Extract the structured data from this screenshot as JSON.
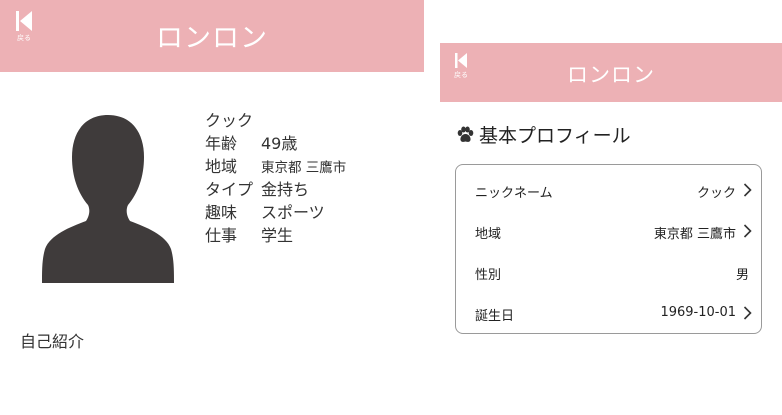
{
  "left_screen": {
    "header": {
      "title": "ロンロン",
      "back_label": "戻る"
    },
    "profile": {
      "nickname": "クック",
      "rows": [
        {
          "label": "年齢",
          "value": "49歳"
        },
        {
          "label": "地域",
          "value": "東京都 三鷹市"
        },
        {
          "label": "タイプ",
          "value": "金持ち"
        },
        {
          "label": "趣味",
          "value": "スポーツ"
        },
        {
          "label": "仕事",
          "value": "学生"
        }
      ]
    },
    "intro_heading": "自己紹介"
  },
  "right_screen": {
    "header": {
      "title": "ロンロン",
      "back_label": "戻る"
    },
    "section_title": "基本プロフィール",
    "rows": [
      {
        "key": "ニックネーム",
        "value": "クック"
      },
      {
        "key": "地域",
        "value": "東京都 三鷹市"
      },
      {
        "key": "性別",
        "value": "男"
      },
      {
        "key": "誕生日",
        "value": "1969-10-01"
      }
    ]
  },
  "colors": {
    "header": "#edb1b5",
    "avatar": "#3f3b3b"
  },
  "icons": {
    "back": "back-arrow-icon",
    "avatar": "person-silhouette-icon",
    "paw": "paw-icon",
    "chevron": "chevron-right-icon"
  }
}
